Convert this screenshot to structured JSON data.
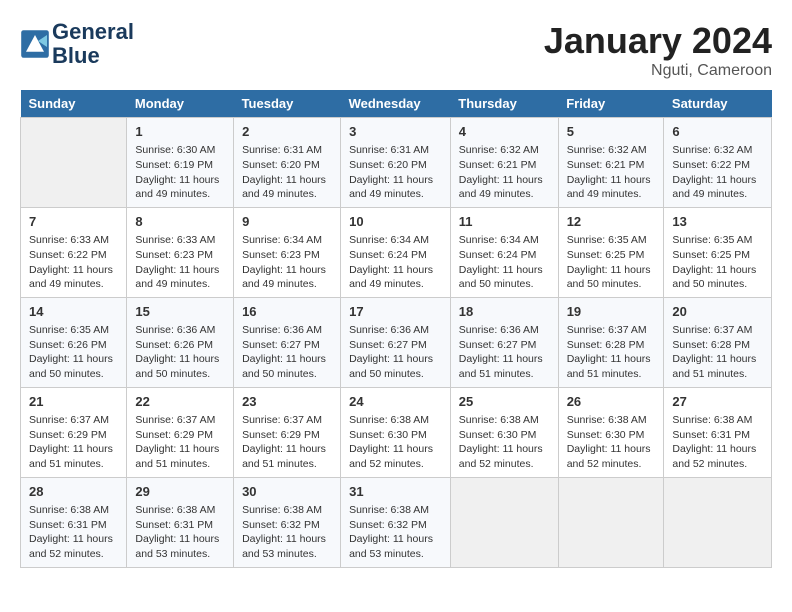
{
  "header": {
    "logo_line1": "General",
    "logo_line2": "Blue",
    "month": "January 2024",
    "location": "Nguti, Cameroon"
  },
  "days_of_week": [
    "Sunday",
    "Monday",
    "Tuesday",
    "Wednesday",
    "Thursday",
    "Friday",
    "Saturday"
  ],
  "weeks": [
    [
      {
        "day": "",
        "info": ""
      },
      {
        "day": "1",
        "info": "Sunrise: 6:30 AM\nSunset: 6:19 PM\nDaylight: 11 hours\nand 49 minutes."
      },
      {
        "day": "2",
        "info": "Sunrise: 6:31 AM\nSunset: 6:20 PM\nDaylight: 11 hours\nand 49 minutes."
      },
      {
        "day": "3",
        "info": "Sunrise: 6:31 AM\nSunset: 6:20 PM\nDaylight: 11 hours\nand 49 minutes."
      },
      {
        "day": "4",
        "info": "Sunrise: 6:32 AM\nSunset: 6:21 PM\nDaylight: 11 hours\nand 49 minutes."
      },
      {
        "day": "5",
        "info": "Sunrise: 6:32 AM\nSunset: 6:21 PM\nDaylight: 11 hours\nand 49 minutes."
      },
      {
        "day": "6",
        "info": "Sunrise: 6:32 AM\nSunset: 6:22 PM\nDaylight: 11 hours\nand 49 minutes."
      }
    ],
    [
      {
        "day": "7",
        "info": "Sunrise: 6:33 AM\nSunset: 6:22 PM\nDaylight: 11 hours\nand 49 minutes."
      },
      {
        "day": "8",
        "info": "Sunrise: 6:33 AM\nSunset: 6:23 PM\nDaylight: 11 hours\nand 49 minutes."
      },
      {
        "day": "9",
        "info": "Sunrise: 6:34 AM\nSunset: 6:23 PM\nDaylight: 11 hours\nand 49 minutes."
      },
      {
        "day": "10",
        "info": "Sunrise: 6:34 AM\nSunset: 6:24 PM\nDaylight: 11 hours\nand 49 minutes."
      },
      {
        "day": "11",
        "info": "Sunrise: 6:34 AM\nSunset: 6:24 PM\nDaylight: 11 hours\nand 50 minutes."
      },
      {
        "day": "12",
        "info": "Sunrise: 6:35 AM\nSunset: 6:25 PM\nDaylight: 11 hours\nand 50 minutes."
      },
      {
        "day": "13",
        "info": "Sunrise: 6:35 AM\nSunset: 6:25 PM\nDaylight: 11 hours\nand 50 minutes."
      }
    ],
    [
      {
        "day": "14",
        "info": "Sunrise: 6:35 AM\nSunset: 6:26 PM\nDaylight: 11 hours\nand 50 minutes."
      },
      {
        "day": "15",
        "info": "Sunrise: 6:36 AM\nSunset: 6:26 PM\nDaylight: 11 hours\nand 50 minutes."
      },
      {
        "day": "16",
        "info": "Sunrise: 6:36 AM\nSunset: 6:27 PM\nDaylight: 11 hours\nand 50 minutes."
      },
      {
        "day": "17",
        "info": "Sunrise: 6:36 AM\nSunset: 6:27 PM\nDaylight: 11 hours\nand 50 minutes."
      },
      {
        "day": "18",
        "info": "Sunrise: 6:36 AM\nSunset: 6:27 PM\nDaylight: 11 hours\nand 51 minutes."
      },
      {
        "day": "19",
        "info": "Sunrise: 6:37 AM\nSunset: 6:28 PM\nDaylight: 11 hours\nand 51 minutes."
      },
      {
        "day": "20",
        "info": "Sunrise: 6:37 AM\nSunset: 6:28 PM\nDaylight: 11 hours\nand 51 minutes."
      }
    ],
    [
      {
        "day": "21",
        "info": "Sunrise: 6:37 AM\nSunset: 6:29 PM\nDaylight: 11 hours\nand 51 minutes."
      },
      {
        "day": "22",
        "info": "Sunrise: 6:37 AM\nSunset: 6:29 PM\nDaylight: 11 hours\nand 51 minutes."
      },
      {
        "day": "23",
        "info": "Sunrise: 6:37 AM\nSunset: 6:29 PM\nDaylight: 11 hours\nand 51 minutes."
      },
      {
        "day": "24",
        "info": "Sunrise: 6:38 AM\nSunset: 6:30 PM\nDaylight: 11 hours\nand 52 minutes."
      },
      {
        "day": "25",
        "info": "Sunrise: 6:38 AM\nSunset: 6:30 PM\nDaylight: 11 hours\nand 52 minutes."
      },
      {
        "day": "26",
        "info": "Sunrise: 6:38 AM\nSunset: 6:30 PM\nDaylight: 11 hours\nand 52 minutes."
      },
      {
        "day": "27",
        "info": "Sunrise: 6:38 AM\nSunset: 6:31 PM\nDaylight: 11 hours\nand 52 minutes."
      }
    ],
    [
      {
        "day": "28",
        "info": "Sunrise: 6:38 AM\nSunset: 6:31 PM\nDaylight: 11 hours\nand 52 minutes."
      },
      {
        "day": "29",
        "info": "Sunrise: 6:38 AM\nSunset: 6:31 PM\nDaylight: 11 hours\nand 53 minutes."
      },
      {
        "day": "30",
        "info": "Sunrise: 6:38 AM\nSunset: 6:32 PM\nDaylight: 11 hours\nand 53 minutes."
      },
      {
        "day": "31",
        "info": "Sunrise: 6:38 AM\nSunset: 6:32 PM\nDaylight: 11 hours\nand 53 minutes."
      },
      {
        "day": "",
        "info": ""
      },
      {
        "day": "",
        "info": ""
      },
      {
        "day": "",
        "info": ""
      }
    ]
  ]
}
